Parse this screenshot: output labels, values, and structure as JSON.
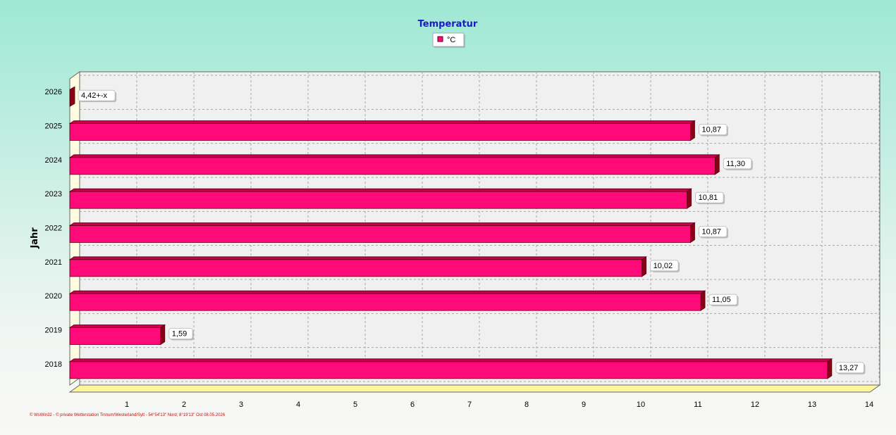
{
  "footer_text": "© WsWin32  -  © private Wetterstation Tinnum/Westerland/Sylt  -  54°54'13\" Nord; 8°19'13\" Ost  08.05.2026",
  "colors": {
    "bar_front": "#ff0a78",
    "bar_top": "#c8004e",
    "bar_side": "#8a0018",
    "plot_bg": "#f0f0f0",
    "grid": "#a8a8a8",
    "title": "#1a1ac8"
  },
  "chart_data": {
    "type": "bar",
    "orientation": "horizontal",
    "title": "Temperatur",
    "ylabel": "Jahr",
    "xlabel": "",
    "legend": [
      {
        "name": "°C",
        "color": "#ff0a78"
      }
    ],
    "legend_position": "top-center",
    "categories": [
      "2018",
      "2019",
      "2020",
      "2021",
      "2022",
      "2023",
      "2024",
      "2025",
      "2026"
    ],
    "series": [
      {
        "name": "°C",
        "values": [
          13.27,
          1.59,
          11.05,
          10.02,
          10.87,
          10.81,
          11.3,
          10.87,
          0
        ]
      }
    ],
    "data_labels": [
      "13,27",
      "1,59",
      "11,05",
      "10,02",
      "10,87",
      "10,81",
      "11,30",
      "10,87",
      "4,42+-x"
    ],
    "x_ticks": [
      "1",
      "2",
      "3",
      "4",
      "5",
      "6",
      "7",
      "8",
      "9",
      "10",
      "11",
      "12",
      "13",
      "14"
    ],
    "xlim": [
      0,
      14
    ],
    "grid": true
  }
}
